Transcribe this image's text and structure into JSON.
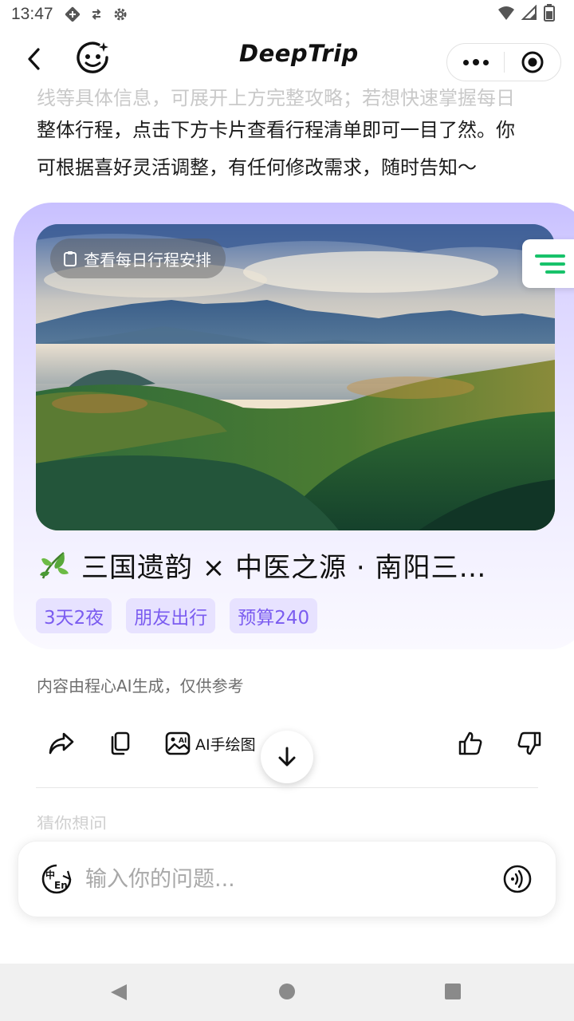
{
  "status_bar": {
    "time": "13:47"
  },
  "nav": {
    "brand": "DeepTrip"
  },
  "message": {
    "faded_line": "线等具体信息，可展开上方完整攻略；若想快速掌握每日",
    "lines": [
      "整体行程，点击下方卡片查看行程清单即可一目了然。你",
      "可根据喜好灵活调整，有任何修改需求，随时告知～"
    ]
  },
  "trip_card": {
    "daily_button": "查看每日行程安排",
    "title": "三国遗韵 × 中医之源 · 南阳三…",
    "tags": [
      "3天2夜",
      "朋友出行",
      "预算240"
    ]
  },
  "disclaimer": "内容由程心AI生成，仅供参考",
  "actions": {
    "ai_drawing_label": "AI手绘图"
  },
  "guess_label": "猜你想问",
  "input": {
    "placeholder": "输入你的问题..."
  },
  "colors": {
    "accent": "#7b5cf0",
    "tag_bg": "#e7e2ff",
    "float_icon": "#18c26a"
  },
  "icons": [
    "back-arrow-icon",
    "ai-face-icon",
    "more-dots-icon",
    "target-icon",
    "share-icon",
    "copy-icon",
    "image-ai-icon",
    "thumbs-up-icon",
    "thumbs-down-icon",
    "arrow-down-icon",
    "language-icon",
    "voice-icon",
    "leaf-icon",
    "clipboard-icon",
    "list-lines-icon"
  ]
}
